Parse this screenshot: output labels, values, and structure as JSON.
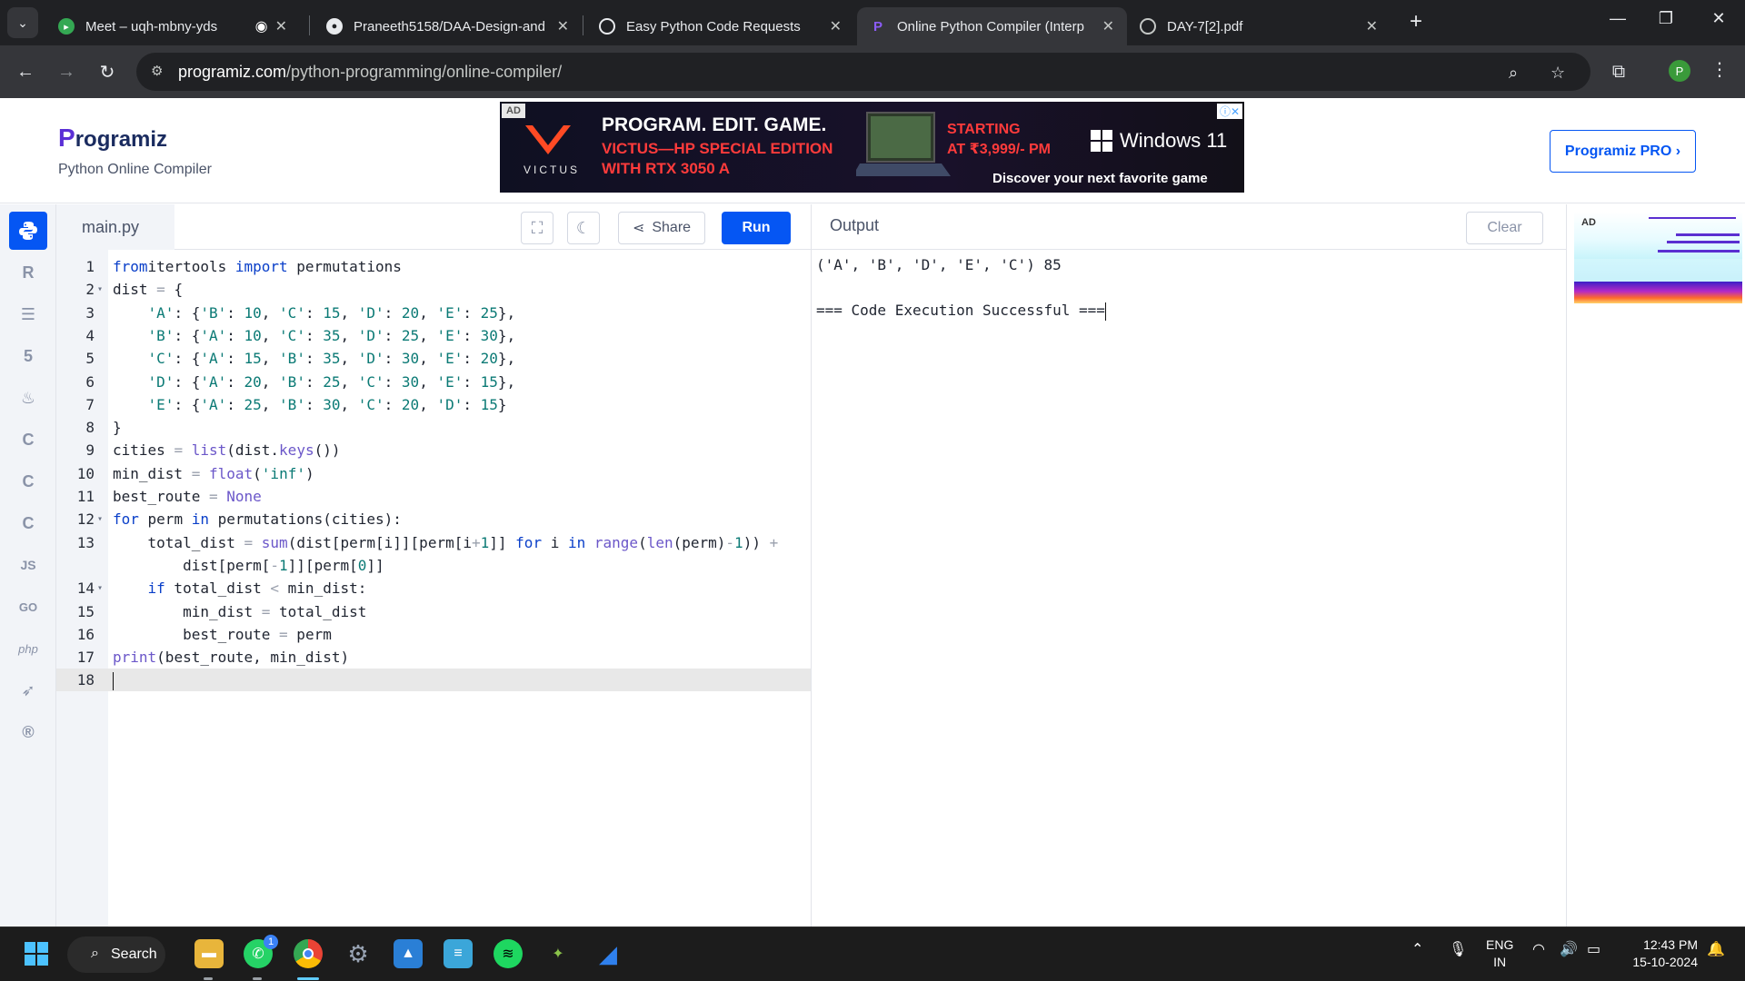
{
  "browser": {
    "tabs": [
      {
        "title": "Meet – uqh-mbny-yds",
        "favicon": "google-meet-icon"
      },
      {
        "title": "Praneeth5158/DAA-Design-and",
        "favicon": "github-icon"
      },
      {
        "title": "Easy Python Code Requests",
        "favicon": "chatgpt-icon"
      },
      {
        "title": "Online Python Compiler (Interp",
        "favicon": "programiz-icon",
        "active": true
      },
      {
        "title": "DAY-7[2].pdf",
        "favicon": "globe-icon"
      }
    ],
    "url_host": "programiz.com",
    "url_path": "/python-programming/online-compiler/",
    "profile_initial": "P"
  },
  "header": {
    "logo_p": "P",
    "logo_rest": "rogramiz",
    "subtitle": "Python Online Compiler",
    "pro_button": "Programiz PRO ›"
  },
  "ad": {
    "tag": "AD",
    "brand": "VICTUS",
    "headline": "PROGRAM. EDIT. GAME.",
    "line2": "VICTUS—HP SPECIAL EDITION",
    "line3": "WITH RTX 3050 A",
    "price1": "STARTING",
    "price2": "AT ₹3,999/- PM",
    "windows": "Windows 11",
    "cta": "Discover your next favorite game"
  },
  "editor": {
    "file_name": "main.py",
    "share_label": "Share",
    "run_label": "Run",
    "lines": [
      {
        "n": "1",
        "fold": "",
        "code": [
          [
            "kw",
            "from"
          ],
          [
            "",
            "itertools "
          ],
          [
            "kw",
            "import"
          ],
          [
            "",
            " permutations"
          ]
        ]
      },
      {
        "n": "2",
        "fold": "▾",
        "code": [
          [
            "",
            "dist "
          ],
          [
            "op",
            "="
          ],
          [
            "",
            " {"
          ]
        ]
      },
      {
        "n": "3",
        "fold": "",
        "code": [
          [
            "",
            "    "
          ],
          [
            "str",
            "'A'"
          ],
          [
            "",
            ": {"
          ],
          [
            "str",
            "'B'"
          ],
          [
            "",
            ": "
          ],
          [
            "num",
            "10"
          ],
          [
            "",
            ", "
          ],
          [
            "str",
            "'C'"
          ],
          [
            "",
            ": "
          ],
          [
            "num",
            "15"
          ],
          [
            "",
            ", "
          ],
          [
            "str",
            "'D'"
          ],
          [
            "",
            ": "
          ],
          [
            "num",
            "20"
          ],
          [
            "",
            ", "
          ],
          [
            "str",
            "'E'"
          ],
          [
            "",
            ": "
          ],
          [
            "num",
            "25"
          ],
          [
            "",
            "},"
          ]
        ]
      },
      {
        "n": "4",
        "fold": "",
        "code": [
          [
            "",
            "    "
          ],
          [
            "str",
            "'B'"
          ],
          [
            "",
            ": {"
          ],
          [
            "str",
            "'A'"
          ],
          [
            "",
            ": "
          ],
          [
            "num",
            "10"
          ],
          [
            "",
            ", "
          ],
          [
            "str",
            "'C'"
          ],
          [
            "",
            ": "
          ],
          [
            "num",
            "35"
          ],
          [
            "",
            ", "
          ],
          [
            "str",
            "'D'"
          ],
          [
            "",
            ": "
          ],
          [
            "num",
            "25"
          ],
          [
            "",
            ", "
          ],
          [
            "str",
            "'E'"
          ],
          [
            "",
            ": "
          ],
          [
            "num",
            "30"
          ],
          [
            "",
            "},"
          ]
        ]
      },
      {
        "n": "5",
        "fold": "",
        "code": [
          [
            "",
            "    "
          ],
          [
            "str",
            "'C'"
          ],
          [
            "",
            ": {"
          ],
          [
            "str",
            "'A'"
          ],
          [
            "",
            ": "
          ],
          [
            "num",
            "15"
          ],
          [
            "",
            ", "
          ],
          [
            "str",
            "'B'"
          ],
          [
            "",
            ": "
          ],
          [
            "num",
            "35"
          ],
          [
            "",
            ", "
          ],
          [
            "str",
            "'D'"
          ],
          [
            "",
            ": "
          ],
          [
            "num",
            "30"
          ],
          [
            "",
            ", "
          ],
          [
            "str",
            "'E'"
          ],
          [
            "",
            ": "
          ],
          [
            "num",
            "20"
          ],
          [
            "",
            "},"
          ]
        ]
      },
      {
        "n": "6",
        "fold": "",
        "code": [
          [
            "",
            "    "
          ],
          [
            "str",
            "'D'"
          ],
          [
            "",
            ": {"
          ],
          [
            "str",
            "'A'"
          ],
          [
            "",
            ": "
          ],
          [
            "num",
            "20"
          ],
          [
            "",
            ", "
          ],
          [
            "str",
            "'B'"
          ],
          [
            "",
            ": "
          ],
          [
            "num",
            "25"
          ],
          [
            "",
            ", "
          ],
          [
            "str",
            "'C'"
          ],
          [
            "",
            ": "
          ],
          [
            "num",
            "30"
          ],
          [
            "",
            ", "
          ],
          [
            "str",
            "'E'"
          ],
          [
            "",
            ": "
          ],
          [
            "num",
            "15"
          ],
          [
            "",
            "},"
          ]
        ]
      },
      {
        "n": "7",
        "fold": "",
        "code": [
          [
            "",
            "    "
          ],
          [
            "str",
            "'E'"
          ],
          [
            "",
            ": {"
          ],
          [
            "str",
            "'A'"
          ],
          [
            "",
            ": "
          ],
          [
            "num",
            "25"
          ],
          [
            "",
            ", "
          ],
          [
            "str",
            "'B'"
          ],
          [
            "",
            ": "
          ],
          [
            "num",
            "30"
          ],
          [
            "",
            ", "
          ],
          [
            "str",
            "'C'"
          ],
          [
            "",
            ": "
          ],
          [
            "num",
            "20"
          ],
          [
            "",
            ", "
          ],
          [
            "str",
            "'D'"
          ],
          [
            "",
            ": "
          ],
          [
            "num",
            "15"
          ],
          [
            "",
            "}"
          ]
        ]
      },
      {
        "n": "8",
        "fold": "",
        "code": [
          [
            "",
            "}"
          ]
        ]
      },
      {
        "n": "9",
        "fold": "",
        "code": [
          [
            "",
            "cities "
          ],
          [
            "op",
            "="
          ],
          [
            "",
            " "
          ],
          [
            "fn",
            "list"
          ],
          [
            "",
            "(dist."
          ],
          [
            "fn",
            "keys"
          ],
          [
            "",
            "())"
          ]
        ]
      },
      {
        "n": "10",
        "fold": "",
        "code": [
          [
            "",
            "min_dist "
          ],
          [
            "op",
            "="
          ],
          [
            "",
            " "
          ],
          [
            "fn",
            "float"
          ],
          [
            "",
            "("
          ],
          [
            "str",
            "'inf'"
          ],
          [
            "",
            ")"
          ]
        ]
      },
      {
        "n": "11",
        "fold": "",
        "code": [
          [
            "",
            "best_route "
          ],
          [
            "op",
            "="
          ],
          [
            "",
            " "
          ],
          [
            "cn",
            "None"
          ]
        ]
      },
      {
        "n": "12",
        "fold": "▾",
        "code": [
          [
            "kw",
            "for"
          ],
          [
            "",
            " perm "
          ],
          [
            "kw",
            "in"
          ],
          [
            "",
            " permutations(cities):"
          ]
        ]
      },
      {
        "n": "13",
        "fold": "",
        "code": [
          [
            "",
            "    total_dist "
          ],
          [
            "op",
            "="
          ],
          [
            "",
            " "
          ],
          [
            "fn",
            "sum"
          ],
          [
            "",
            "(dist[perm[i]][perm[i"
          ],
          [
            "op",
            "+"
          ],
          [
            "num",
            "1"
          ],
          [
            "",
            "]] "
          ],
          [
            "kw",
            "for"
          ],
          [
            "",
            " i "
          ],
          [
            "kw",
            "in"
          ],
          [
            "",
            " "
          ],
          [
            "fn",
            "range"
          ],
          [
            "",
            "("
          ],
          [
            "fn",
            "len"
          ],
          [
            "",
            "(perm)"
          ],
          [
            "op",
            "-"
          ],
          [
            "num",
            "1"
          ],
          [
            "",
            "))"
          ],
          [
            "",
            " "
          ],
          [
            "op",
            "+"
          ]
        ]
      },
      {
        "n": "",
        "fold": "",
        "code": [
          [
            "",
            "        dist[perm["
          ],
          [
            "op",
            "-"
          ],
          [
            "num",
            "1"
          ],
          [
            "",
            "]][perm["
          ],
          [
            "num",
            "0"
          ],
          [
            "",
            "]]"
          ]
        ]
      },
      {
        "n": "14",
        "fold": "▾",
        "code": [
          [
            "",
            "    "
          ],
          [
            "kw",
            "if"
          ],
          [
            "",
            " total_dist "
          ],
          [
            "op",
            "<"
          ],
          [
            "",
            " min_dist:"
          ]
        ]
      },
      {
        "n": "15",
        "fold": "",
        "code": [
          [
            "",
            "        min_dist "
          ],
          [
            "op",
            "="
          ],
          [
            "",
            " total_dist"
          ]
        ]
      },
      {
        "n": "16",
        "fold": "",
        "code": [
          [
            "",
            "        best_route "
          ],
          [
            "op",
            "="
          ],
          [
            "",
            " perm"
          ]
        ]
      },
      {
        "n": "17",
        "fold": "",
        "code": [
          [
            "fn",
            "print"
          ],
          [
            "",
            "(best_route, min_dist)"
          ]
        ]
      },
      {
        "n": "18",
        "fold": "",
        "code": [],
        "current": true
      }
    ]
  },
  "output": {
    "title": "Output",
    "clear_label": "Clear",
    "lines": [
      "('A', 'B', 'D', 'E', 'C') 85",
      "",
      "=== Code Execution Successful ==="
    ]
  },
  "side_ad": {
    "tag": "AD"
  },
  "taskbar": {
    "search_label": "Search",
    "whatsapp_badge": "1",
    "lang_top": "ENG",
    "lang_bottom": "IN",
    "time": "12:43 PM",
    "date": "15-10-2024"
  },
  "colors": {
    "accent": "#0556f3",
    "chrome_dark": "#202124",
    "chrome_toolbar": "#35363a",
    "keyword": "#0a3fc9",
    "string": "#0b7a75"
  }
}
